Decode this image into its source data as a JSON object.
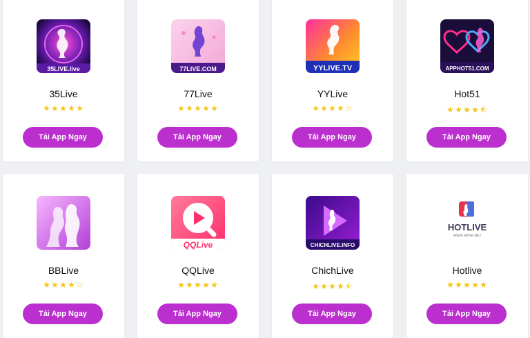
{
  "apps": [
    {
      "name": "35Live",
      "rating": 5,
      "logo_text": "35LIVE.live",
      "button": "Tải App Ngay"
    },
    {
      "name": "77Live",
      "rating": 5,
      "logo_text": "77LIVE.COM",
      "button": "Tải App Ngay"
    },
    {
      "name": "YYLive",
      "rating": 4,
      "logo_text": "YYLIVE.TV",
      "button": "Tải App Ngay"
    },
    {
      "name": "Hot51",
      "rating": 4.5,
      "logo_text": "APPHOT51.COM",
      "button": "Tải App Ngay"
    },
    {
      "name": "BBLive",
      "rating": 4,
      "logo_text": "",
      "button": "Tải App Ngay"
    },
    {
      "name": "QQLive",
      "rating": 5,
      "logo_text": "QQLive",
      "button": "Tải App Ngay"
    },
    {
      "name": "ChichLive",
      "rating": 4.5,
      "logo_text": "CHICHLIVE.INFO",
      "button": "Tải App Ngay"
    },
    {
      "name": "Hotlive",
      "rating": 5,
      "logo_text": "HOTLIVE",
      "logo_subtext": "WWW.IWINK.NET",
      "button": "Tải App Ngay"
    }
  ],
  "colors": {
    "button": "#bb2fcf",
    "star": "#f5c518",
    "background": "#eef0f4"
  },
  "icons": {
    "star_full": "★",
    "star_empty": "☆",
    "star_half": "⯪"
  }
}
